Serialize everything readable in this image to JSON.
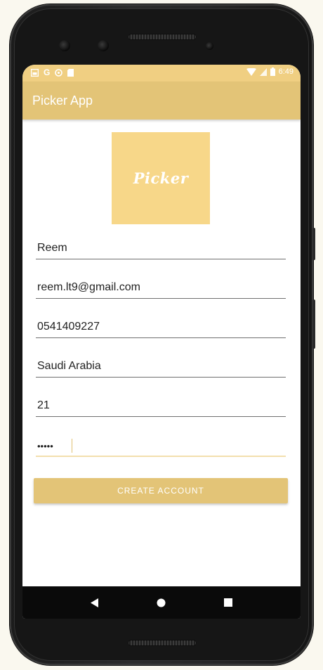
{
  "status_bar": {
    "time": "6:49",
    "notification_icons": [
      "image-icon",
      "google-g-icon",
      "settings-icon",
      "sd-card-icon"
    ],
    "system_icons": [
      "wifi-icon",
      "signal-icon",
      "battery-icon"
    ],
    "g_glyph": "G"
  },
  "app_bar": {
    "title": "Picker App"
  },
  "logo": {
    "text": "Picker",
    "color": "#f7d789"
  },
  "form": {
    "fields": [
      {
        "value": "Reem"
      },
      {
        "value": "reem.lt9@gmail.com"
      },
      {
        "value": "0541409227"
      },
      {
        "value": "Saudi Arabia"
      },
      {
        "value": "21"
      },
      {
        "value": "•••••"
      }
    ],
    "submit_label": "CREATE ACCOUNT"
  },
  "nav_bar": {
    "items": [
      "back-icon",
      "home-icon",
      "recents-icon"
    ]
  },
  "colors": {
    "primary": "#e3c477",
    "primary_dark": "#f0cf82",
    "accent_underline": "#f3dfae"
  }
}
